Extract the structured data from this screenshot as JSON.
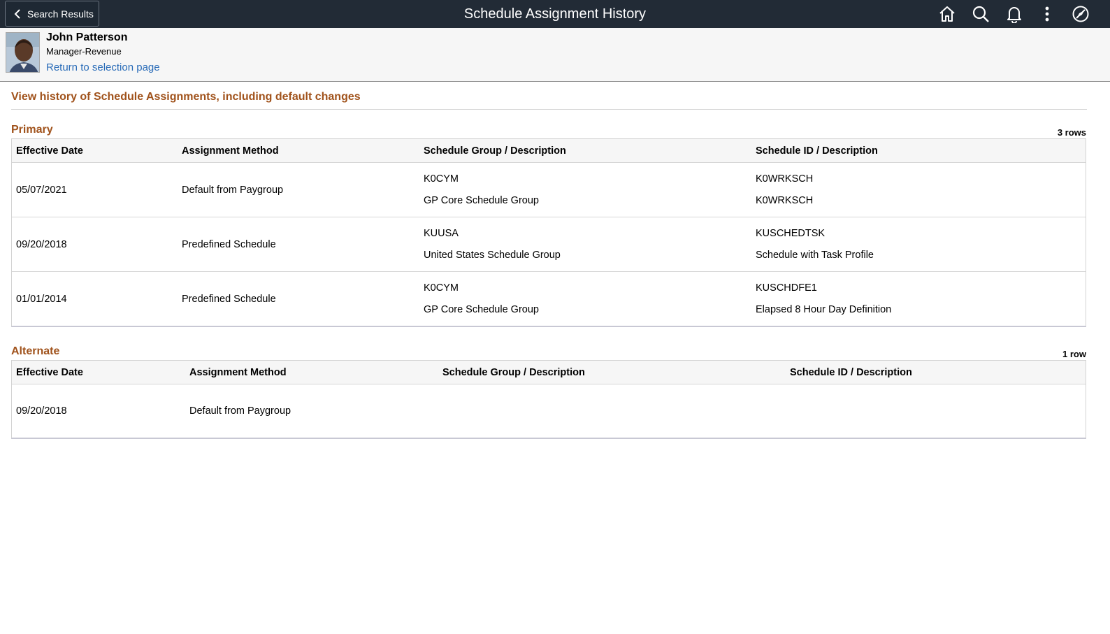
{
  "banner": {
    "back_label": "Search Results",
    "title": "Schedule Assignment History",
    "icons": [
      "home-icon",
      "search-icon",
      "bell-icon",
      "more-vertical-icon",
      "compass-icon"
    ]
  },
  "employee": {
    "name": "John Patterson",
    "job_title": "Manager-Revenue",
    "return_link": "Return to selection page"
  },
  "page": {
    "heading": "View history of Schedule Assignments, including default changes"
  },
  "primary": {
    "title": "Primary",
    "row_count": "3 rows",
    "columns": [
      "Effective Date",
      "Assignment Method",
      "Schedule Group / Description",
      "Schedule ID / Description"
    ],
    "rows": [
      {
        "effective_date": "05/07/2021",
        "method": "Default from Paygroup",
        "group_code": "K0CYM",
        "group_desc": "GP Core Schedule Group",
        "schedule_code": "K0WRKSCH",
        "schedule_desc": "K0WRKSCH"
      },
      {
        "effective_date": "09/20/2018",
        "method": "Predefined Schedule",
        "group_code": "KUUSA",
        "group_desc": "United States Schedule Group",
        "schedule_code": "KUSCHEDTSK",
        "schedule_desc": "Schedule with Task Profile"
      },
      {
        "effective_date": "01/01/2014",
        "method": "Predefined Schedule",
        "group_code": "K0CYM",
        "group_desc": "GP Core Schedule Group",
        "schedule_code": "KUSCHDFE1",
        "schedule_desc": "Elapsed 8 Hour Day Definition"
      }
    ]
  },
  "alternate": {
    "title": "Alternate",
    "row_count": "1 row",
    "columns": [
      "Effective Date",
      "Assignment Method",
      "Schedule Group / Description",
      "Schedule ID / Description"
    ],
    "rows": [
      {
        "effective_date": "09/20/2018",
        "method": "Default from Paygroup"
      }
    ]
  }
}
